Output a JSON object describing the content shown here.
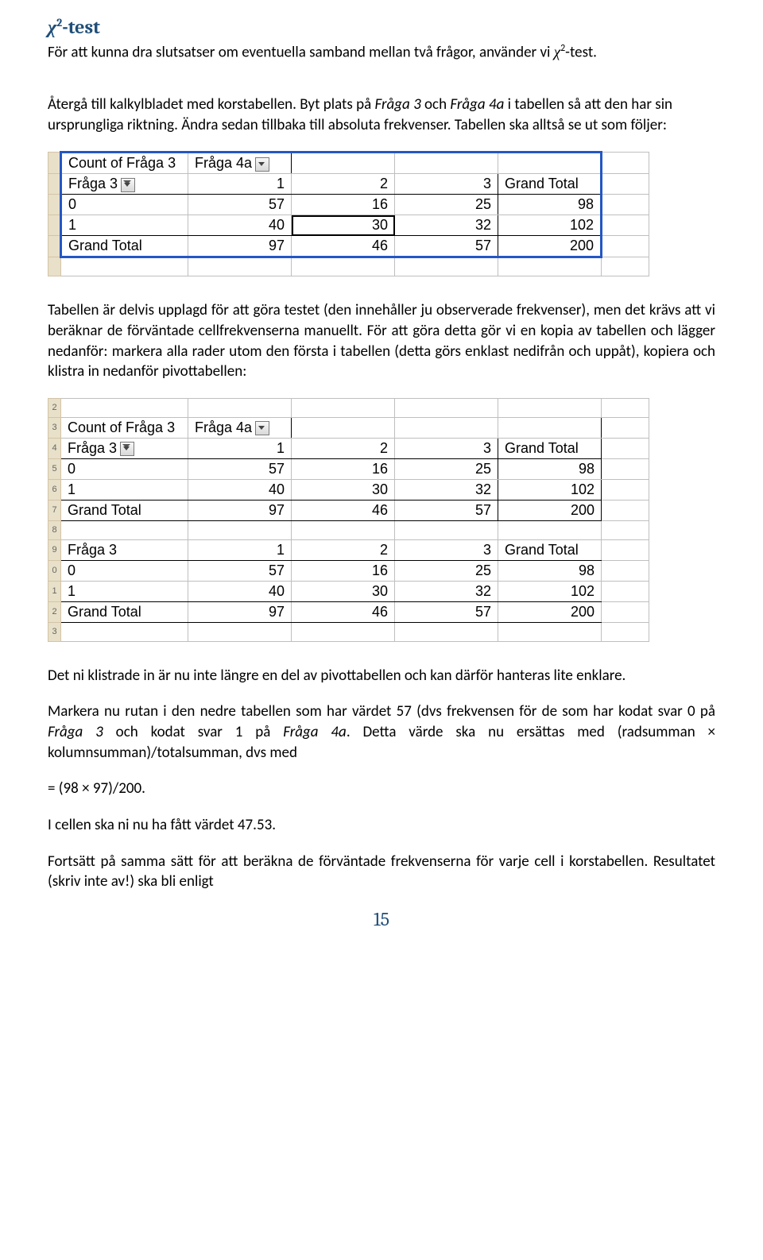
{
  "heading_prefix": "χ",
  "heading_sup": "2",
  "heading_suffix": "-test",
  "p1_a": "För att kunna dra slutsatser om eventuella samband mellan två frågor, använder vi ",
  "p1_chi": "χ",
  "p1_sup": "2",
  "p1_b": "-test.",
  "p2_a": "Återgå till kalkylbladet med korstabellen. Byt plats på ",
  "p2_i1": "Fråga 3",
  "p2_b": " och ",
  "p2_i2": "Fråga 4a",
  "p2_c": " i tabellen så att den har sin ursprungliga riktning. Ändra sedan tillbaka till absoluta frekvenser. Tabellen ska alltså se ut som följer:",
  "table1": {
    "count_label": "Count of Fråga 3",
    "colfield": "Fråga 4a",
    "rowfield": "Fråga 3",
    "cols": [
      "1",
      "2",
      "3",
      "Grand Total"
    ],
    "rows": [
      {
        "label": "0",
        "cells": [
          "57",
          "16",
          "25",
          "98"
        ]
      },
      {
        "label": "1",
        "cells": [
          "40",
          "30",
          "32",
          "102"
        ]
      }
    ],
    "grand_label": "Grand Total",
    "grand": [
      "97",
      "46",
      "57",
      "200"
    ]
  },
  "p3": "Tabellen är delvis upplagd för att göra testet (den innehåller ju observerade frekvenser), men det krävs att vi beräknar de förväntade cellfrekvenserna manuellt. För att göra detta gör vi en kopia av tabellen och lägger nedanför: markera alla rader utom den första i tabellen (detta görs enklast nedifrån och uppåt), kopiera och klistra in nedanför pivottabellen:",
  "table2": {
    "upper": {
      "count_label": "Count of Fråga 3",
      "colfield": "Fråga 4a",
      "rowfield": "Fråga 3",
      "cols": [
        "1",
        "2",
        "3",
        "Grand Total"
      ],
      "rows": [
        {
          "label": "0",
          "cells": [
            "57",
            "16",
            "25",
            "98"
          ]
        },
        {
          "label": "1",
          "cells": [
            "40",
            "30",
            "32",
            "102"
          ]
        }
      ],
      "grand_label": "Grand Total",
      "grand": [
        "97",
        "46",
        "57",
        "200"
      ]
    },
    "lower": {
      "rowfield": "Fråga 3",
      "cols": [
        "1",
        "2",
        "3",
        "Grand Total"
      ],
      "rows": [
        {
          "label": "0",
          "cells": [
            "57",
            "16",
            "25",
            "98"
          ]
        },
        {
          "label": "1",
          "cells": [
            "40",
            "30",
            "32",
            "102"
          ]
        }
      ],
      "grand_label": "Grand Total",
      "grand": [
        "97",
        "46",
        "57",
        "200"
      ]
    },
    "rownums": [
      "2",
      "3",
      "4",
      "5",
      "6",
      "7",
      "8",
      "9",
      "0",
      "1",
      "2",
      "3"
    ]
  },
  "p4": "Det ni klistrade in är nu inte längre en del av pivottabellen och kan därför hanteras lite enklare.",
  "p5_a": "Markera nu rutan i den nedre tabellen som har värdet 57 (dvs frekvensen för de som har kodat svar 0 på ",
  "p5_i1": "Fråga 3",
  "p5_b": " och kodat svar 1 på ",
  "p5_i2": "Fråga 4a",
  "p5_c": ". Detta värde ska nu ersättas med (radsumman × kolumnsumman)/totalsumman, dvs med",
  "p6": "= (98 × 97)/200.",
  "p7": "I cellen ska ni nu ha fått värdet 47.53.",
  "p8": "Fortsätt på samma sätt för att beräkna de förväntade frekvenserna för varje cell i korstabellen. Resultatet (skriv inte av!) ska bli enligt",
  "page_num": "15"
}
